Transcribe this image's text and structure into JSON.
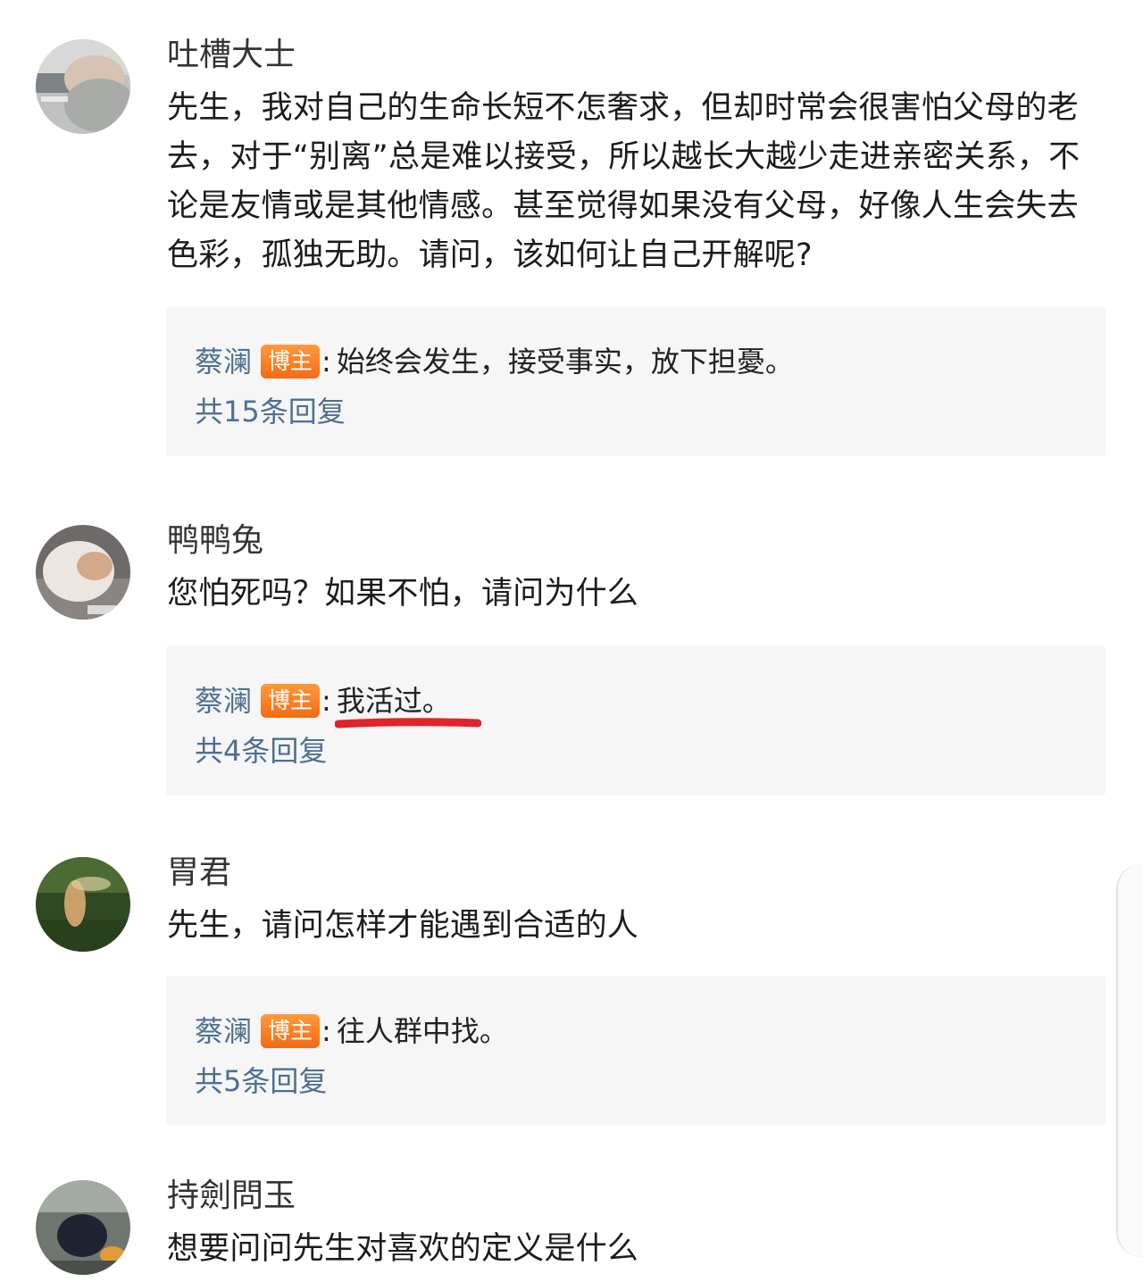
{
  "comments": [
    {
      "username": "吐槽大士",
      "text": "先生，我对自己的生命长短不怎奢求，但却时常会很害怕父母的老去，对于“别离”总是难以接受，所以越长大越少走进亲密关系，不论是友情或是其他情感。甚至觉得如果没有父母，好像人生会失去色彩，孤独无助。请问，该如何让自己开解呢?",
      "reply": {
        "author": "蔡澜",
        "badge": "博主",
        "colon": ":",
        "text": "始终会发生，接受事实，放下担憂。",
        "count": "共15条回复"
      }
    },
    {
      "username": "鸭鸭兔",
      "text": "您怕死吗？如果不怕，请问为什么",
      "reply": {
        "author": "蔡澜",
        "badge": "博主",
        "colon": ":",
        "text": "我活过。",
        "count": "共4条回复"
      }
    },
    {
      "username": "胃君",
      "text": "先生，请问怎样才能遇到合适的人",
      "reply": {
        "author": "蔡澜",
        "badge": "博主",
        "colon": ":",
        "text": "往人群中找。",
        "count": "共5条回复"
      }
    },
    {
      "username": "持劍問玉",
      "text": "想要问问先生对喜欢的定义是什么"
    }
  ],
  "colors": {
    "link": "#4e6f92",
    "badge": "#f26b16",
    "reply_bg": "#f6f6f6",
    "underline": "#e0242b"
  }
}
